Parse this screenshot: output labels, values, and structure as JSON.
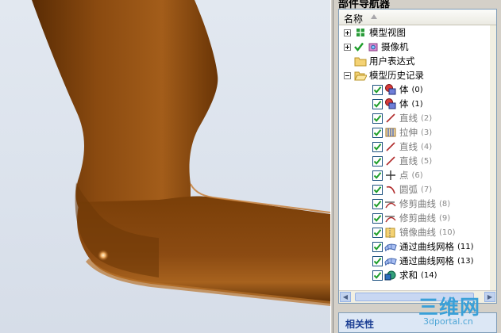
{
  "panel": {
    "title": "部件导航器",
    "column_header": "名称",
    "bottom_section": "相关性"
  },
  "tree": [
    {
      "label": "模型视图",
      "expander": "plus",
      "icon": "model-view-icon",
      "dim": false
    },
    {
      "label": "摄像机",
      "expander": "plus",
      "icon": "camera-icon",
      "dim": false,
      "check": true
    },
    {
      "label": "用户表达式",
      "expander": "none",
      "icon": "folder-icon",
      "dim": false
    },
    {
      "label": "模型历史记录",
      "expander": "minus",
      "icon": "folder-open-icon",
      "dim": false
    },
    {
      "label": "体",
      "count": "(0)",
      "icon": "body-icon",
      "dim": false
    },
    {
      "label": "体",
      "count": "(1)",
      "icon": "body-icon",
      "dim": false
    },
    {
      "label": "直线",
      "count": "(2)",
      "icon": "line-icon",
      "dim": true
    },
    {
      "label": "拉伸",
      "count": "(3)",
      "icon": "extrude-icon",
      "dim": true
    },
    {
      "label": "直线",
      "count": "(4)",
      "icon": "line-icon",
      "dim": true
    },
    {
      "label": "直线",
      "count": "(5)",
      "icon": "line-icon",
      "dim": true
    },
    {
      "label": "点",
      "count": "(6)",
      "icon": "point-icon",
      "dim": true
    },
    {
      "label": "圆弧",
      "count": "(7)",
      "icon": "arc-icon",
      "dim": true
    },
    {
      "label": "修剪曲线",
      "count": "(8)",
      "icon": "trim-curve-icon",
      "dim": true
    },
    {
      "label": "修剪曲线",
      "count": "(9)",
      "icon": "trim-curve-icon",
      "dim": true
    },
    {
      "label": "镜像曲线",
      "count": "(10)",
      "icon": "mirror-curve-icon",
      "dim": true
    },
    {
      "label": "通过曲线网格",
      "count": "(11)",
      "icon": "curve-mesh-icon",
      "dim": false
    },
    {
      "label": "通过曲线网格",
      "count": "(13)",
      "icon": "curve-mesh-icon",
      "dim": false
    },
    {
      "label": "求和",
      "count": "(14)",
      "icon": "unite-icon",
      "dim": false
    }
  ],
  "watermark": {
    "main": "三维网",
    "url": "3dportal.cn"
  },
  "colors": {
    "model_brown": "#7a3f08",
    "check_green": "#1e9e2a",
    "accent_blue": "#1c3f94"
  }
}
